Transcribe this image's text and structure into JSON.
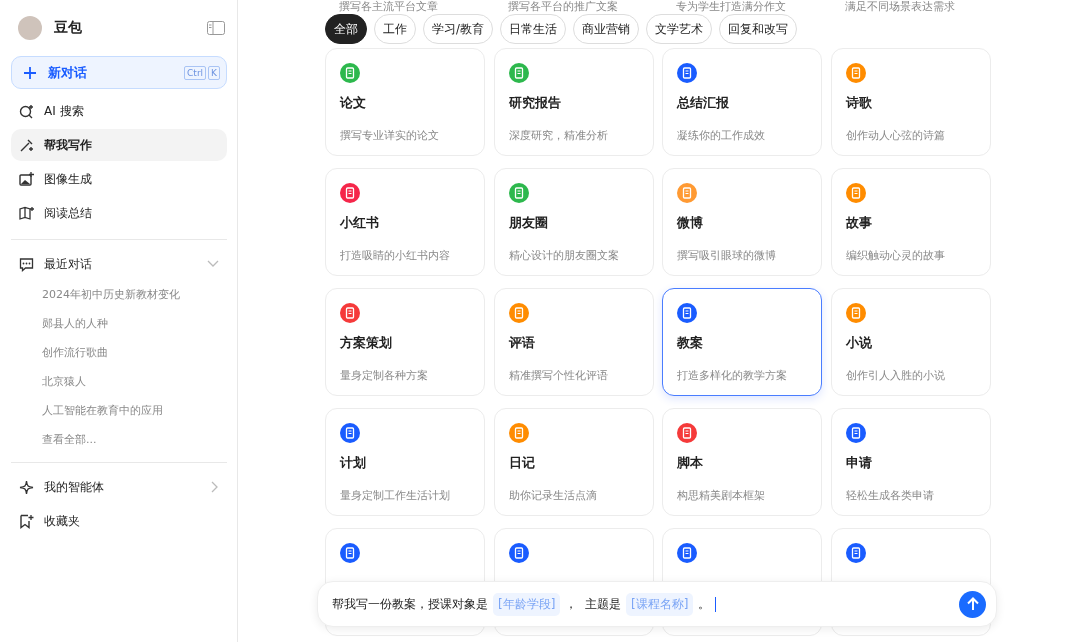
{
  "sidebar": {
    "title": "豆包",
    "new_chat": {
      "label": "新对话",
      "shortcut": [
        "Ctrl",
        "K"
      ]
    },
    "nav": [
      {
        "kind": "search",
        "label": "AI 搜索",
        "selected": false
      },
      {
        "kind": "write",
        "label": "帮我写作",
        "selected": true
      },
      {
        "kind": "image",
        "label": "图像生成",
        "selected": false
      },
      {
        "kind": "read",
        "label": "阅读总结",
        "selected": false
      }
    ],
    "recent": {
      "title": "最近对话",
      "expanded": true,
      "items": [
        "2024年初中历史新教材变化",
        "郧县人的人种",
        "创作流行歌曲",
        "北京猿人",
        "人工智能在教育中的应用",
        "查看全部..."
      ]
    },
    "agents": {
      "label": "我的智能体"
    },
    "favorites": {
      "label": "收藏夹"
    }
  },
  "filters": [
    {
      "label": "全部",
      "selected": true
    },
    {
      "label": "工作",
      "selected": false
    },
    {
      "label": "学习/教育",
      "selected": false
    },
    {
      "label": "日常生活",
      "selected": false
    },
    {
      "label": "商业营销",
      "selected": false
    },
    {
      "label": "文学艺术",
      "selected": false
    },
    {
      "label": "回复和改写",
      "selected": false
    }
  ],
  "cut_row": [
    "撰写各主流平台文章",
    "撰写各平台的推广文案",
    "专为学生打造满分作文",
    "满足不同场景表达需求"
  ],
  "cards": [
    {
      "title": "论文",
      "desc": "撰写专业详实的论文",
      "color": "#2db84d",
      "selected": false
    },
    {
      "title": "研究报告",
      "desc": "深度研究，精准分析",
      "color": "#2db84d",
      "selected": false
    },
    {
      "title": "总结汇报",
      "desc": "凝练你的工作成效",
      "color": "#1a5cff",
      "selected": false
    },
    {
      "title": "诗歌",
      "desc": "创作动人心弦的诗篇",
      "color": "#ff8c00",
      "selected": false
    },
    {
      "title": "小红书",
      "desc": "打造吸睛的小红书内容",
      "color": "#f5264a",
      "selected": false
    },
    {
      "title": "朋友圈",
      "desc": "精心设计的朋友圈文案",
      "color": "#2db84d",
      "selected": false
    },
    {
      "title": "微博",
      "desc": "撰写吸引眼球的微博",
      "color": "#ff9a33",
      "selected": false
    },
    {
      "title": "故事",
      "desc": "编织触动心灵的故事",
      "color": "#ff8c00",
      "selected": false
    },
    {
      "title": "方案策划",
      "desc": "量身定制各种方案",
      "color": "#f53a3a",
      "selected": false
    },
    {
      "title": "评语",
      "desc": "精准撰写个性化评语",
      "color": "#ff8c00",
      "selected": false
    },
    {
      "title": "教案",
      "desc": "打造多样化的教学方案",
      "color": "#1a5cff",
      "selected": true
    },
    {
      "title": "小说",
      "desc": "创作引人入胜的小说",
      "color": "#ff8c00",
      "selected": false
    },
    {
      "title": "计划",
      "desc": "量身定制工作生活计划",
      "color": "#1a5cff",
      "selected": false
    },
    {
      "title": "日记",
      "desc": "助你记录生活点滴",
      "color": "#ff8c00",
      "selected": false
    },
    {
      "title": "脚本",
      "desc": "构思精美剧本框架",
      "color": "#f53a3a",
      "selected": false
    },
    {
      "title": "申请",
      "desc": "轻松生成各类申请",
      "color": "#1a5cff",
      "selected": false
    },
    {
      "color": "#1a5cff",
      "selected": false
    },
    {
      "color": "#1a5cff",
      "selected": false
    },
    {
      "color": "#1a5cff",
      "selected": false
    },
    {
      "color": "#1a5cff",
      "selected": false
    }
  ],
  "prompt": [
    {
      "kind": "text",
      "text": "帮我写一份教案，授课对象是"
    },
    {
      "kind": "slot",
      "text": "[年龄学段]"
    },
    {
      "kind": "text",
      "text": "，  主题是"
    },
    {
      "kind": "slot",
      "text": "[课程名称]"
    },
    {
      "kind": "text",
      "text": "。"
    }
  ]
}
